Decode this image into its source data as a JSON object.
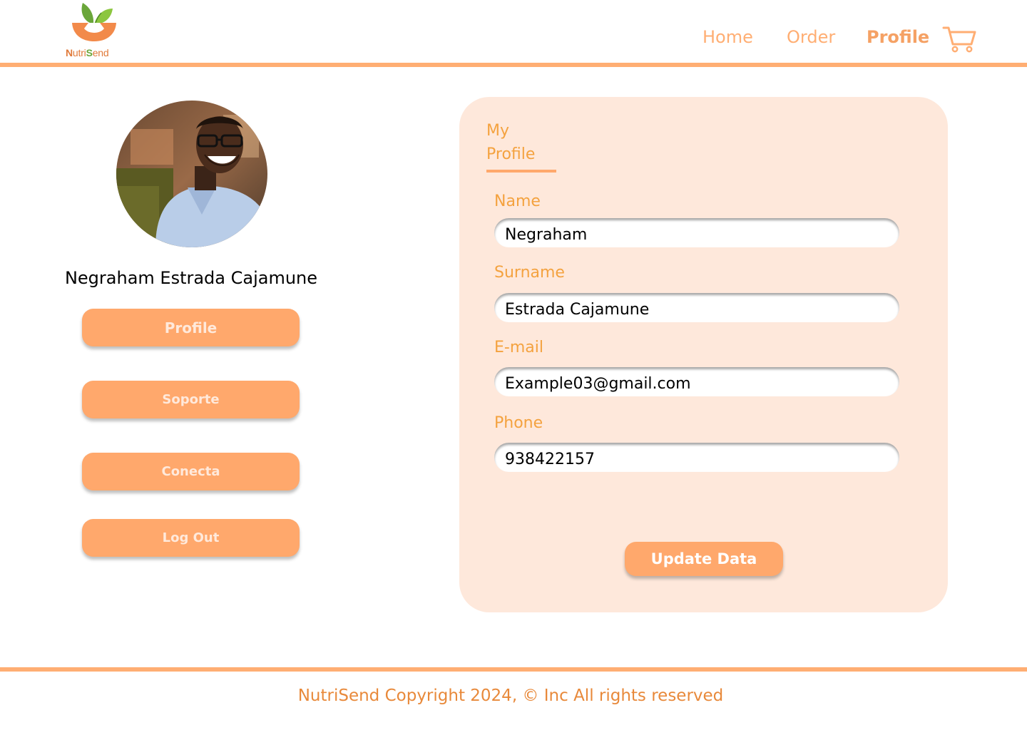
{
  "brand": {
    "name_prefix": "N",
    "name_mid": "utri",
    "name_s": "S",
    "name_suffix": "end",
    "logo_icon": "bowl-with-leaves-logo",
    "colors": {
      "accent": "#ffae73",
      "button": "#ffa86c",
      "label": "#f4a23f",
      "card": "#fee8db",
      "green": "#6aa63a"
    }
  },
  "nav": {
    "home": "Home",
    "order": "Order",
    "profile": "Profile",
    "cart_icon": "shopping-cart-icon"
  },
  "sidebar": {
    "user_name": "Negraham Estrada Cajamune",
    "buttons": {
      "profile": "Profile",
      "soporte": "Soporte",
      "conecta": "Conecta",
      "logout": "Log Out"
    }
  },
  "form": {
    "title": "My Profile",
    "fields": {
      "name": {
        "label": "Name",
        "value": "Negraham"
      },
      "surname": {
        "label": "Surname",
        "value": "Estrada Cajamune"
      },
      "email": {
        "label": "E-mail",
        "value": "Example03@gmail.com"
      },
      "phone": {
        "label": "Phone",
        "value": "938422157"
      }
    },
    "submit": "Update Data"
  },
  "footer": {
    "copyright": "NutriSend Copyright 2024, © Inc All rights reserved"
  }
}
